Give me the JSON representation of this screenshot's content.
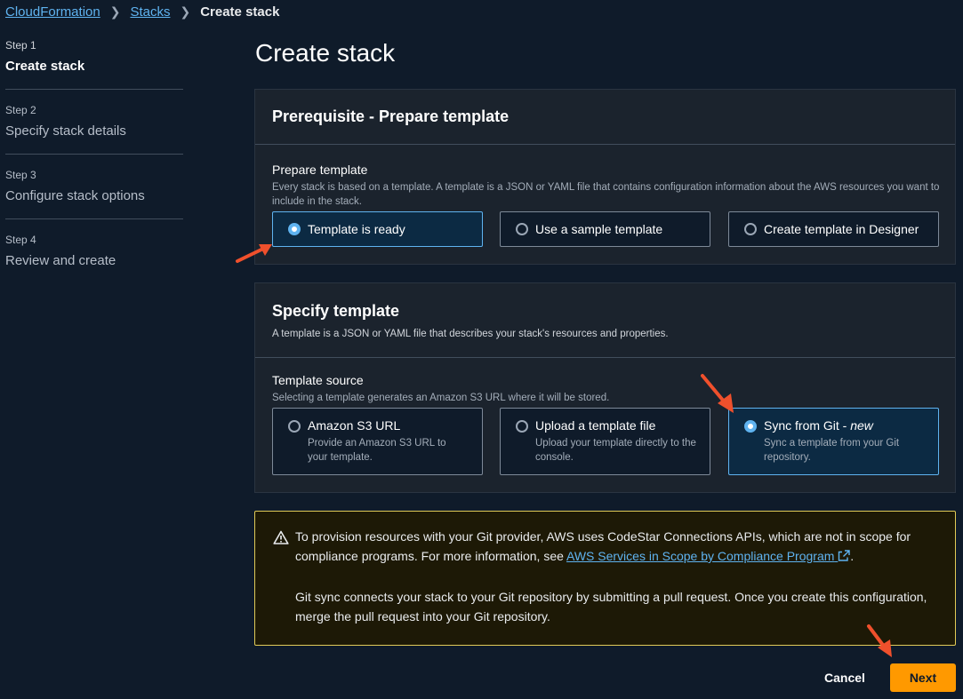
{
  "breadcrumb": {
    "items": [
      "CloudFormation",
      "Stacks"
    ],
    "current": "Create stack"
  },
  "steps": [
    {
      "num": "Step 1",
      "name": "Create stack",
      "active": true
    },
    {
      "num": "Step 2",
      "name": "Specify stack details",
      "active": false
    },
    {
      "num": "Step 3",
      "name": "Configure stack options",
      "active": false
    },
    {
      "num": "Step 4",
      "name": "Review and create",
      "active": false
    }
  ],
  "page_title": "Create stack",
  "prerequisite": {
    "title": "Prerequisite - Prepare template",
    "field_label": "Prepare template",
    "field_desc": "Every stack is based on a template. A template is a JSON or YAML file that contains configuration information about the AWS resources you want to include in the stack.",
    "options": [
      {
        "label": "Template is ready",
        "selected": true
      },
      {
        "label": "Use a sample template",
        "selected": false
      },
      {
        "label": "Create template in Designer",
        "selected": false
      }
    ]
  },
  "specify": {
    "title": "Specify template",
    "subtitle": "A template is a JSON or YAML file that describes your stack's resources and properties.",
    "field_label": "Template source",
    "field_desc": "Selecting a template generates an Amazon S3 URL where it will be stored.",
    "options": [
      {
        "label": "Amazon S3 URL",
        "label_suffix": "",
        "desc": "Provide an Amazon S3 URL to your template.",
        "selected": false
      },
      {
        "label": "Upload a template file",
        "label_suffix": "",
        "desc": "Upload your template directly to the console.",
        "selected": false
      },
      {
        "label": "Sync from Git - ",
        "label_suffix": "new",
        "desc": "Sync a template from your Git repository.",
        "selected": true
      }
    ]
  },
  "alert": {
    "text1_a": "To provision resources with your Git provider, AWS uses CodeStar Connections APIs, which are not in scope for compliance programs. For more information, see ",
    "link": "AWS Services in Scope by Compliance Program",
    "text1_b": ".",
    "text2": "Git sync connects your stack to your Git repository by submitting a pull request. Once you create this configuration, merge the pull request into your Git repository."
  },
  "buttons": {
    "cancel": "Cancel",
    "next": "Next"
  },
  "colors": {
    "background": "#0f1b2a",
    "accent": "#5fb3f0",
    "primary_button": "#ff9900",
    "warning_border": "#e0ca57",
    "annotation_arrow": "#f0502c"
  }
}
